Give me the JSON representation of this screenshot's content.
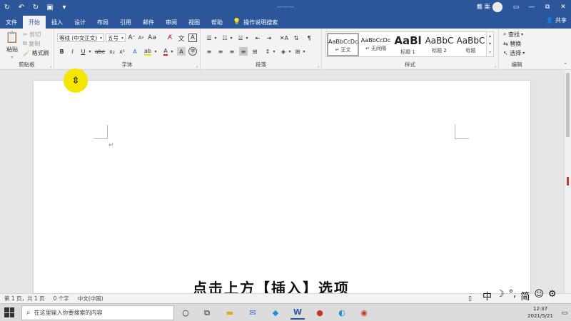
{
  "title_bar": {
    "doc_title": "———",
    "user": "戴 栗",
    "restore_glyph": "⧉"
  },
  "tabs": [
    {
      "label": "文件"
    },
    {
      "label": "开始",
      "active": true
    },
    {
      "label": "插入"
    },
    {
      "label": "设计"
    },
    {
      "label": "布局"
    },
    {
      "label": "引用"
    },
    {
      "label": "邮件"
    },
    {
      "label": "审阅"
    },
    {
      "label": "视图"
    },
    {
      "label": "帮助"
    }
  ],
  "tell_me": "操作说明搜索",
  "share": "共享",
  "clipboard": {
    "paste": "粘贴",
    "cut": "剪切",
    "copy": "复制",
    "format_painter": "格式刷",
    "label": "剪贴板"
  },
  "font": {
    "name": "等线 (中文正文)",
    "size": "五号",
    "grow": "A",
    "shrink": "A",
    "wen": "文",
    "label": "字体"
  },
  "paragraph": {
    "label": "段落"
  },
  "styles": {
    "label": "样式",
    "items": [
      {
        "sample": "AaBbCcDc",
        "name": "正文",
        "prefix": "↵"
      },
      {
        "sample": "AaBbCcDc",
        "name": "无间隔",
        "prefix": "↵"
      },
      {
        "sample": "AaBl",
        "name": "标题 1",
        "prefix": ""
      },
      {
        "sample": "AaBbC",
        "name": "标题 2",
        "prefix": ""
      },
      {
        "sample": "AaBbC",
        "name": "标题",
        "prefix": ""
      }
    ]
  },
  "editing": {
    "find": "查找",
    "replace": "替换",
    "select": "选择",
    "label": "编辑"
  },
  "document": {
    "paragraph_mark": "↵"
  },
  "status": {
    "page": "第 1 页，共 1 页",
    "words": "0 个字",
    "language": "中文(中国)"
  },
  "subtitle": "点击上方【插入】选项",
  "ime": {
    "zhong": "中",
    "moon": "☽",
    "punct": "°,",
    "simplified": "简",
    "smile": "☺",
    "gear": "⚙"
  },
  "taskbar": {
    "search_placeholder": "在这里输入你要搜索的内容",
    "time": "12:37",
    "date": "2021/5/21"
  },
  "colors": {
    "word_blue": "#2b579a",
    "highlight_yellow": "#f4e600",
    "font_red": "#e02020"
  }
}
